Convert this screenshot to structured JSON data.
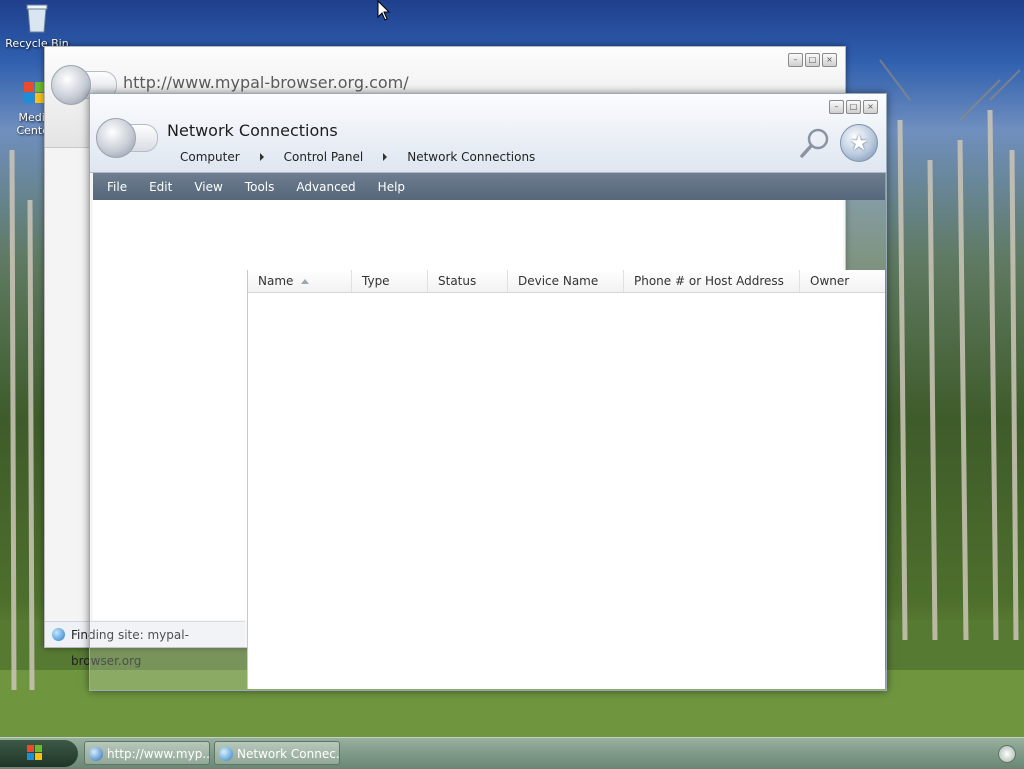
{
  "desktop": {
    "icons": [
      {
        "label": "Recycle Bin"
      },
      {
        "label": "Media Center"
      }
    ]
  },
  "back_window": {
    "url": "http://www.mypal-browser.org.com/",
    "status": "Finding site: mypal-browser.org"
  },
  "main_window": {
    "title": "Network Connections",
    "breadcrumb": [
      "Computer",
      "Control Panel",
      "Network Connections"
    ],
    "menu": [
      "File",
      "Edit",
      "View",
      "Tools",
      "Advanced",
      "Help"
    ],
    "list": {
      "columns": [
        "Name",
        "Type",
        "Status",
        "Device Name",
        "Phone # or Host Address",
        "Owner"
      ]
    }
  },
  "taskbar": {
    "tasks": [
      "http://www.myp...",
      "Network Connec..."
    ]
  }
}
